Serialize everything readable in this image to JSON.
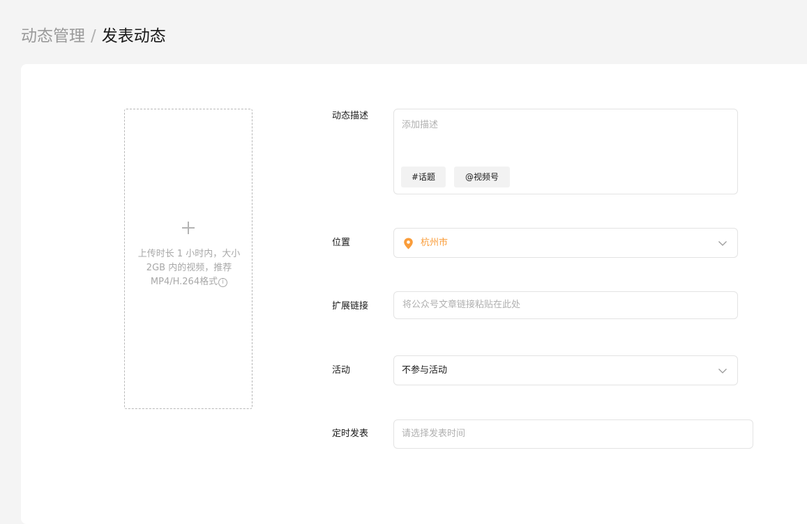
{
  "breadcrumb": {
    "parent": "动态管理",
    "separator": "/",
    "current": "发表动态"
  },
  "upload": {
    "text": "上传时长 1 小时内，大小 2GB 内的视频，推荐MP4/H.264格式",
    "info_icon": "i"
  },
  "form": {
    "description": {
      "label": "动态描述",
      "placeholder": "添加描述",
      "tags": [
        "#话题",
        "@视频号"
      ]
    },
    "location": {
      "label": "位置",
      "value": "杭州市"
    },
    "link": {
      "label": "扩展链接",
      "placeholder": "将公众号文章链接粘贴在此处"
    },
    "activity": {
      "label": "活动",
      "value": "不参与活动"
    },
    "schedule": {
      "label": "定时发表",
      "placeholder": "请选择发表时间"
    }
  },
  "colors": {
    "accent": "#fa9d3b",
    "background": "#f4f4f4",
    "card": "#ffffff",
    "placeholder": "#b0b0b0",
    "border": "#e3e3e3"
  },
  "icons": {
    "upload": "plus-icon",
    "info": "info-icon",
    "location": "location-pin-icon",
    "dropdown": "chevron-down-icon"
  }
}
